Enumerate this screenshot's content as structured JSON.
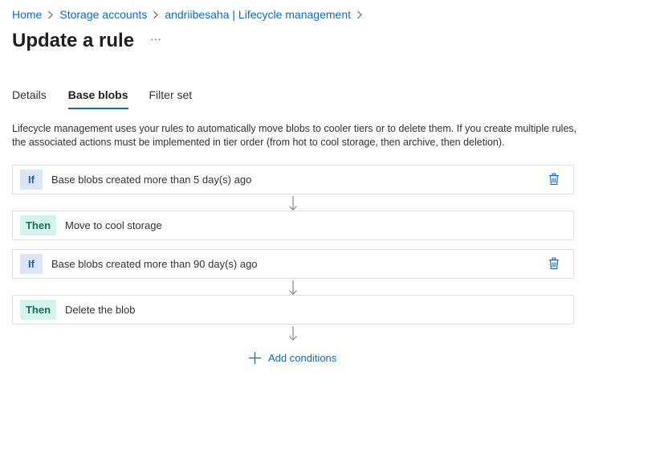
{
  "breadcrumb": {
    "items": [
      "Home",
      "Storage accounts",
      "andriibesaha | Lifecycle management"
    ]
  },
  "page": {
    "title": "Update a rule",
    "more_label": "···"
  },
  "tabs": [
    {
      "label": "Details",
      "active": false
    },
    {
      "label": "Base blobs",
      "active": true
    },
    {
      "label": "Filter set",
      "active": false
    }
  ],
  "description": "Lifecycle management uses your rules to automatically move blobs to cooler tiers or to delete them. If you create multiple rules, the associated actions must be implemented in tier order (from hot to cool storage, then archive, then deletion).",
  "rules": [
    {
      "if_badge": "If",
      "if_text": "Base blobs created more than 5 day(s) ago",
      "then_badge": "Then",
      "then_text": "Move to cool storage"
    },
    {
      "if_badge": "If",
      "if_text": "Base blobs created more than 90 day(s) ago",
      "then_badge": "Then",
      "then_text": "Delete the blob"
    }
  ],
  "add_conditions_label": "Add conditions",
  "icons": {
    "breadcrumb_separator": "chevron-right-icon",
    "delete": "trash-icon",
    "arrow": "arrow-down-icon",
    "add": "plus-icon"
  },
  "colors": {
    "link": "#0f6cbd",
    "if_badge_bg": "#dbe6fb",
    "then_badge_bg": "#d3f3ec"
  }
}
